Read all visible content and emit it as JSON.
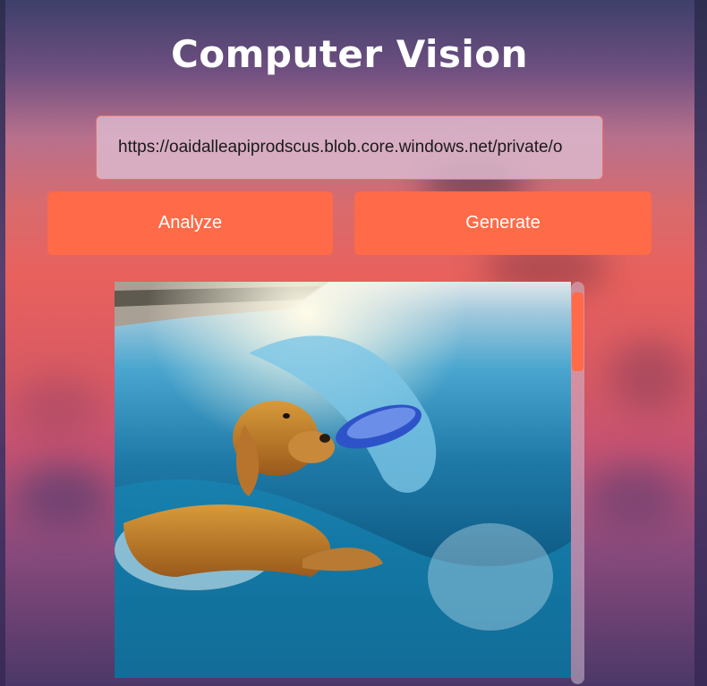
{
  "app": {
    "title": "Computer Vision"
  },
  "url_input": {
    "value": "https://oaidalleapiprodscus.blob.core.windows.net/private/o"
  },
  "buttons": {
    "analyze": "Analyze",
    "generate": "Generate"
  },
  "image": {
    "subject": "golden retriever catching a blue frisbee in ocean waves"
  },
  "colors": {
    "accent": "#ff6a48",
    "title": "#ffffff",
    "input_border": "#e5736c"
  },
  "icons": {
    "scrollbar": "scrollbar-thumb"
  }
}
